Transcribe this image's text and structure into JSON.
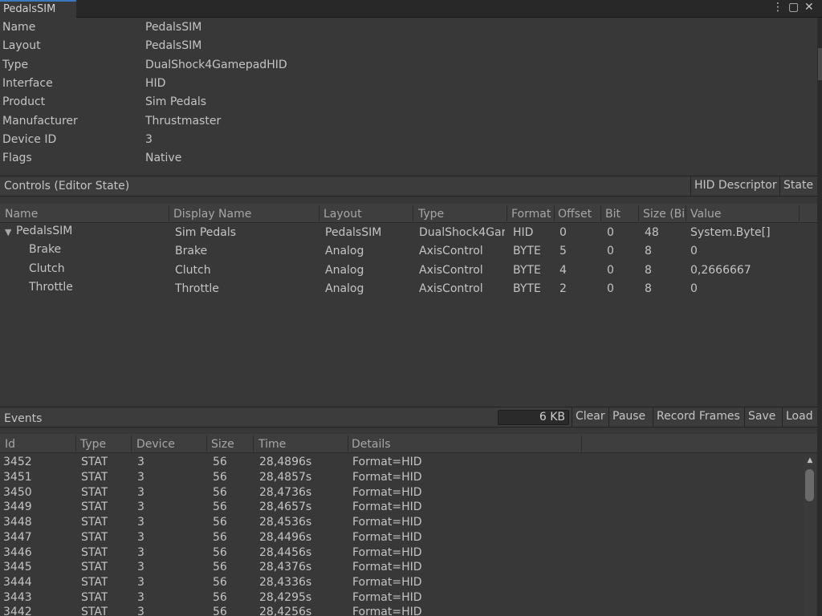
{
  "window": {
    "tab_title": "PedalsSIM",
    "menu_glyph": "⋮",
    "maximize_glyph": "▢",
    "close_glyph": "✕"
  },
  "properties": [
    {
      "key": "Name",
      "value": "PedalsSIM"
    },
    {
      "key": "Layout",
      "value": "PedalsSIM"
    },
    {
      "key": "Type",
      "value": "DualShock4GamepadHID"
    },
    {
      "key": "Interface",
      "value": "HID"
    },
    {
      "key": "Product",
      "value": "Sim Pedals"
    },
    {
      "key": "Manufacturer",
      "value": "Thrustmaster"
    },
    {
      "key": "Device ID",
      "value": "3"
    },
    {
      "key": "Flags",
      "value": "Native"
    }
  ],
  "controls": {
    "title": "Controls (Editor State)",
    "buttons": {
      "hid_descriptor": "HID Descriptor",
      "state": "State"
    },
    "columns": [
      "Name",
      "Display Name",
      "Layout",
      "Type",
      "Format",
      "Offset",
      "Bit",
      "Size (Bi",
      "Value"
    ],
    "rows": [
      {
        "name": "PedalsSIM",
        "display": "Sim Pedals",
        "layout": "PedalsSIM",
        "type": "DualShock4Gar",
        "format": "HID",
        "offset": "0",
        "bit": "0",
        "size": "48",
        "value": "System.Byte[]"
      },
      {
        "name": "Brake",
        "display": "Brake",
        "layout": "Analog",
        "type": "AxisControl",
        "format": "BYTE",
        "offset": "5",
        "bit": "0",
        "size": "8",
        "value": "0"
      },
      {
        "name": "Clutch",
        "display": "Clutch",
        "layout": "Analog",
        "type": "AxisControl",
        "format": "BYTE",
        "offset": "4",
        "bit": "0",
        "size": "8",
        "value": "0,2666667"
      },
      {
        "name": "Throttle",
        "display": "Throttle",
        "layout": "Analog",
        "type": "AxisControl",
        "format": "BYTE",
        "offset": "2",
        "bit": "0",
        "size": "8",
        "value": "0"
      }
    ]
  },
  "events": {
    "title": "Events",
    "size": "6 KB",
    "buttons": {
      "clear": "Clear",
      "pause": "Pause",
      "record": "Record Frames",
      "save": "Save",
      "load": "Load"
    },
    "columns": [
      "Id",
      "Type",
      "Device",
      "Size",
      "Time",
      "Details"
    ],
    "rows": [
      {
        "id": "3452",
        "type": "STAT",
        "device": "3",
        "size": "56",
        "time": "28,4896s",
        "details": "Format=HID"
      },
      {
        "id": "3451",
        "type": "STAT",
        "device": "3",
        "size": "56",
        "time": "28,4857s",
        "details": "Format=HID"
      },
      {
        "id": "3450",
        "type": "STAT",
        "device": "3",
        "size": "56",
        "time": "28,4736s",
        "details": "Format=HID"
      },
      {
        "id": "3449",
        "type": "STAT",
        "device": "3",
        "size": "56",
        "time": "28,4657s",
        "details": "Format=HID"
      },
      {
        "id": "3448",
        "type": "STAT",
        "device": "3",
        "size": "56",
        "time": "28,4536s",
        "details": "Format=HID"
      },
      {
        "id": "3447",
        "type": "STAT",
        "device": "3",
        "size": "56",
        "time": "28,4496s",
        "details": "Format=HID"
      },
      {
        "id": "3446",
        "type": "STAT",
        "device": "3",
        "size": "56",
        "time": "28,4456s",
        "details": "Format=HID"
      },
      {
        "id": "3445",
        "type": "STAT",
        "device": "3",
        "size": "56",
        "time": "28,4376s",
        "details": "Format=HID"
      },
      {
        "id": "3444",
        "type": "STAT",
        "device": "3",
        "size": "56",
        "time": "28,4336s",
        "details": "Format=HID"
      },
      {
        "id": "3443",
        "type": "STAT",
        "device": "3",
        "size": "56",
        "time": "28,4295s",
        "details": "Format=HID"
      },
      {
        "id": "3442",
        "type": "STAT",
        "device": "3",
        "size": "56",
        "time": "28,4256s",
        "details": "Format=HID"
      }
    ]
  },
  "colors": {
    "background": "#383838",
    "tab_accent": "#3a79bb",
    "text": "#c4c4c4"
  }
}
